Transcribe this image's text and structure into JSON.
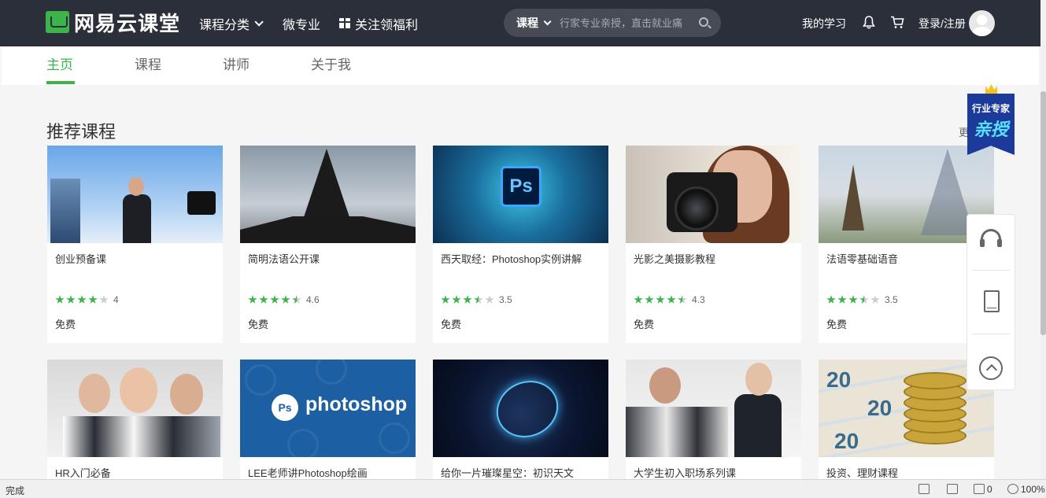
{
  "header": {
    "logo_text": "网易云课堂",
    "nav": {
      "category": "课程分类",
      "micro_major": "微专业",
      "gift": "关注领福利"
    },
    "search": {
      "scope": "课程",
      "placeholder": "行家专业亲授，直击就业痛"
    },
    "my_study": "我的学习",
    "login": "登录/注册"
  },
  "subnav": {
    "tabs": [
      {
        "label": "主页",
        "active": true
      },
      {
        "label": "课程",
        "active": false
      },
      {
        "label": "讲师",
        "active": false
      },
      {
        "label": "关于我",
        "active": false
      }
    ]
  },
  "section": {
    "title": "推荐课程",
    "more": "更"
  },
  "courses": [
    {
      "title": "创业预备课",
      "rating": "4",
      "stars": 4.0,
      "price": "免费"
    },
    {
      "title": "简明法语公开课",
      "rating": "4.6",
      "stars": 4.5,
      "price": "免费"
    },
    {
      "title": "西天取经：Photoshop实例讲解",
      "rating": "3.5",
      "stars": 3.5,
      "price": "免费"
    },
    {
      "title": "光影之美摄影教程",
      "rating": "4.3",
      "stars": 4.5,
      "price": "免费"
    },
    {
      "title": "法语零基础语音",
      "rating": "3.5",
      "stars": 3.5,
      "price": "免费"
    },
    {
      "title": "HR入门必备"
    },
    {
      "title": "LEE老师讲Photoshop绘画"
    },
    {
      "title": "给你一片璀璨星空：初识天文"
    },
    {
      "title": "大学生初入职场系列课"
    },
    {
      "title": "投资、理财课程"
    }
  ],
  "thumb_text": {
    "ps_badge": "Ps",
    "ps_logo": "Ps",
    "photoshop": "photoshop",
    "euro": "20"
  },
  "promo": {
    "line1": "行业专家",
    "line2": "亲授"
  },
  "side_toolbar": [
    "headset-icon",
    "tablet-icon",
    "back-to-top-icon"
  ],
  "statusbar": {
    "status": "完成",
    "count": "0",
    "zoom": "100%"
  },
  "colors": {
    "brand_green": "#3cb44b",
    "topbar": "#2b2f3a",
    "promo_blue": "#1b3a9a"
  }
}
